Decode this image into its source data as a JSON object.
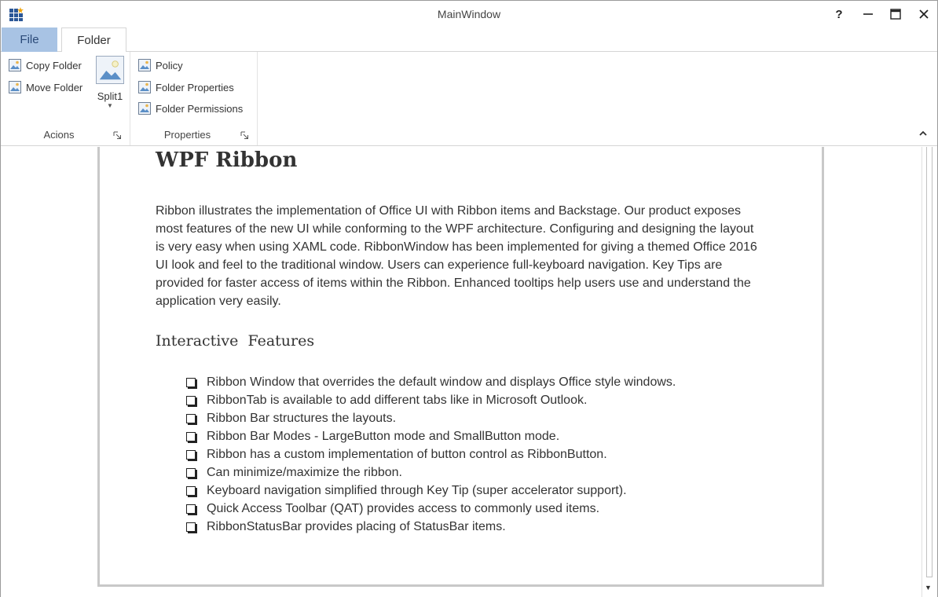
{
  "window": {
    "title": "MainWindow",
    "help_label": "?",
    "minimize_label": "—",
    "maximize_label": "☐",
    "close_label": "✕"
  },
  "tabs": [
    {
      "label": "File",
      "selected": false,
      "color": "#a8c3e4"
    },
    {
      "label": "Folder",
      "selected": true
    }
  ],
  "ribbon": {
    "groups": [
      {
        "label": "Acions",
        "small_buttons": [
          {
            "label": "Copy Folder",
            "icon": "picture-icon"
          },
          {
            "label": "Move Folder",
            "icon": "picture-icon"
          }
        ],
        "large_button": {
          "label": "Split1",
          "icon": "picture-icon",
          "dropdown": true
        }
      },
      {
        "label": "Properties",
        "small_buttons": [
          {
            "label": "Policy",
            "icon": "picture-icon"
          },
          {
            "label": "Folder Properties",
            "icon": "picture-icon"
          },
          {
            "label": "Folder Permissions",
            "icon": "picture-icon"
          }
        ]
      }
    ]
  },
  "document": {
    "title": "WPF Ribbon",
    "paragraph": "Ribbon illustrates the implementation of Office UI with Ribbon items and Backstage. Our product exposes most features of the new UI while conforming to the WPF architecture. Configuring and designing the layout is very easy when using XAML code. RibbonWindow has been implemented for giving a themed Office 2016 UI look and feel to the traditional window. Users can experience full-keyboard navigation. Key Tips are provided for faster access of items within the Ribbon. Enhanced tooltips help users use and understand the application very easily.",
    "subheading": "Interactive  Features",
    "features": [
      "Ribbon Window that overrides the default window and displays Office style windows.",
      "RibbonTab is available to add different tabs like in Microsoft Outlook.",
      "Ribbon Bar structures the layouts.",
      "Ribbon Bar Modes - LargeButton mode and SmallButton mode.",
      "Ribbon has a custom implementation of button control as RibbonButton.",
      "Can minimize/maximize the ribbon.",
      "Keyboard navigation simplified through Key Tip (super accelerator support).",
      "Quick Access Toolbar (QAT) provides access to commonly used items.",
      "RibbonStatusBar provides placing of StatusBar items."
    ]
  }
}
